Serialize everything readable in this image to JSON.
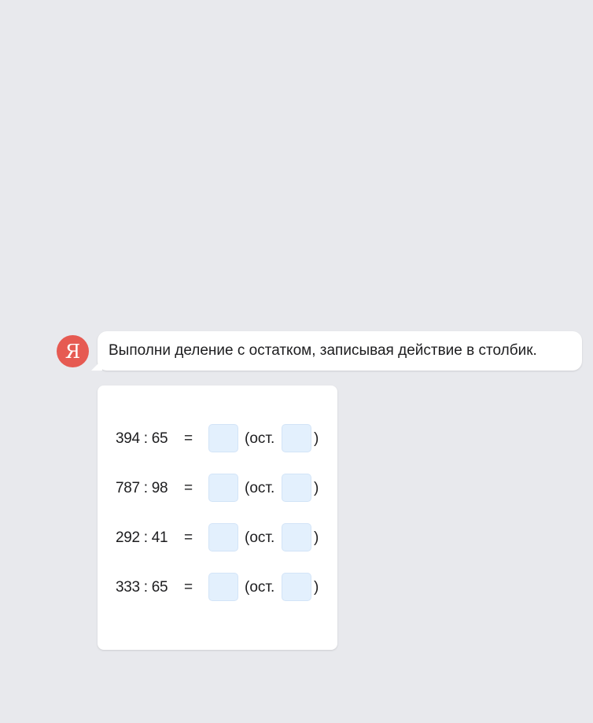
{
  "avatar": {
    "letter": "Я",
    "color": "#e65a52"
  },
  "message": {
    "text": "Выполни деление с остатком, записывая действие в столбик."
  },
  "task": {
    "rows": [
      {
        "expression": "394 : 65",
        "equals": "=",
        "quotient": "",
        "remainder_label": "(ост.",
        "remainder": "",
        "close": ")"
      },
      {
        "expression": "787 : 98",
        "equals": "=",
        "quotient": "",
        "remainder_label": "(ост.",
        "remainder": "",
        "close": ")"
      },
      {
        "expression": "292 : 41",
        "equals": "=",
        "quotient": "",
        "remainder_label": "(ост.",
        "remainder": "",
        "close": ")"
      },
      {
        "expression": "333 : 65",
        "equals": "=",
        "quotient": "",
        "remainder_label": "(ост.",
        "remainder": "",
        "close": ")"
      }
    ]
  },
  "colors": {
    "background": "#e8e9ed",
    "input_fill": "#e3f0fd",
    "card": "#ffffff"
  }
}
